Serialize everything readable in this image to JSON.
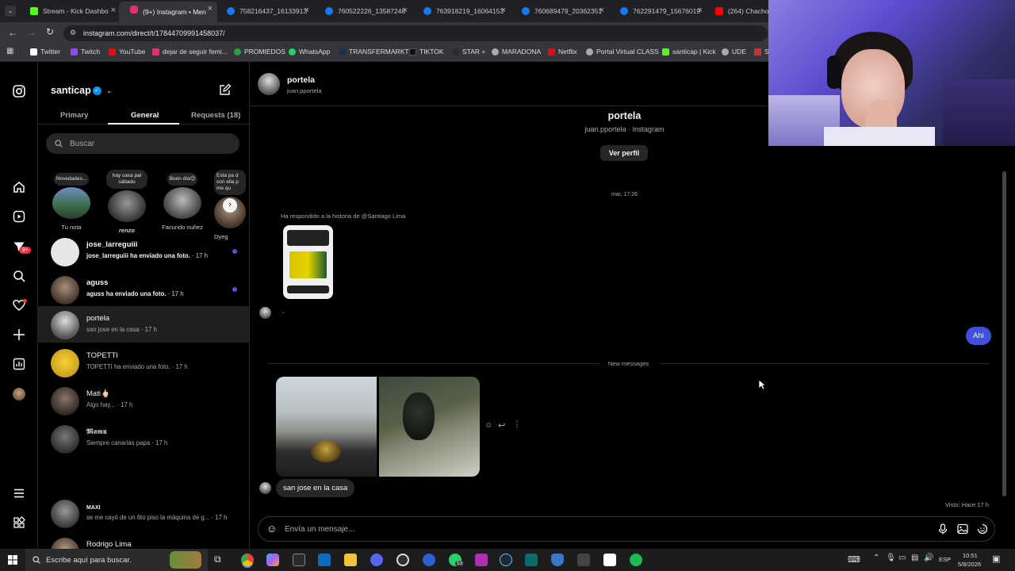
{
  "browser": {
    "tabs": [
      {
        "title": "Stream - Kick Dashbo",
        "color": "#53fc18"
      },
      {
        "title": "(9+) Instagram • Men",
        "color": "#e1306c"
      },
      {
        "title": "758216437_16133913",
        "color": "#1877f2"
      },
      {
        "title": "760522226_13587248",
        "color": "#1877f2"
      },
      {
        "title": "763918219_16064153",
        "color": "#1877f2"
      },
      {
        "title": "760689479_20362351",
        "color": "#1877f2"
      },
      {
        "title": "762291479_15676019",
        "color": "#1877f2"
      },
      {
        "title": "(264) Chacho R",
        "color": "#ff0000"
      }
    ],
    "url": "instagram.com/direct/t/17844709991458037/",
    "bookmarks": [
      "Twitter",
      "Twitch",
      "YouTube",
      "dejar de seguir femi...",
      "PROMIEDOS",
      "WhatsApp",
      "TRANSFERMARKT",
      "TIKTOK",
      "STAR +",
      "MARADONA",
      "Netflix",
      "Portal Virtual CLASS",
      "santicap | Kick",
      "UDE",
      "S"
    ]
  },
  "nav": {
    "badge": "9+"
  },
  "inbox": {
    "username": "santicap",
    "tabs": {
      "primary": "Primary",
      "general": "General",
      "requests": "Requests (18)"
    },
    "search_placeholder": "Buscar",
    "notes": [
      {
        "bubble": "Novedades...",
        "label": "Tu nota"
      },
      {
        "bubble": "hay casa pal sábado",
        "label": "renzo"
      },
      {
        "bubble": "Buen día😉",
        "label": "Facundo nuñez"
      },
      {
        "bubble": "Esta pa d con ella p me qu",
        "label": "Dyeg"
      }
    ],
    "conversations": [
      {
        "name": "jose_larreguiii",
        "preview": "jose_larreguiii ha enviado una foto.",
        "time": "· 17 h",
        "unread": true
      },
      {
        "name": "aguss",
        "preview": "aguss ha enviado una foto.",
        "time": "· 17 h",
        "unread": true
      },
      {
        "name": "portela",
        "preview": "san jose en la casa",
        "time": "· 17 h",
        "unread": false
      },
      {
        "name": "TOPETTI",
        "preview": "TOPETTI ha enviado una foto.",
        "time": "· 17 h",
        "unread": false
      },
      {
        "name": "Mati🖕🏻",
        "preview": "Algo hay...",
        "time": "· 17 h",
        "unread": false
      },
      {
        "name": "𝕸𝖆𝖒𝖚",
        "preview": "Siempre canarias papa",
        "time": "· 17 h",
        "unread": false
      },
      {
        "name": "MAXI",
        "preview": "se me cayó de un 6to piso la máquina de g...",
        "time": "· 17 h",
        "unread": false
      },
      {
        "name": "Rodrigo Lima",
        "preview": "",
        "time": "",
        "unread": false
      }
    ]
  },
  "thread": {
    "header_name": "portela",
    "header_user": "juan.pportela",
    "profile_name": "portela",
    "profile_sub": "juan.pportela · Instagram",
    "view_profile": "Ver perfil",
    "timestamp": "mar, 17:26",
    "story_reply_label": "Ha respondido a la historia de @Santiago Lima",
    "small_msg": ".",
    "sent_msg": "Ahi",
    "new_messages": "New messages",
    "last_msg": "san jose en la casa",
    "seen": "Visto: Hace 17 h",
    "composer_placeholder": "Envía un mensaje..."
  },
  "taskbar": {
    "search_placeholder": "Escribe aquí para buscar.",
    "whatsapp_badge": "53",
    "lang": "ESP",
    "time": "10:51",
    "date": "5/8/2026"
  }
}
